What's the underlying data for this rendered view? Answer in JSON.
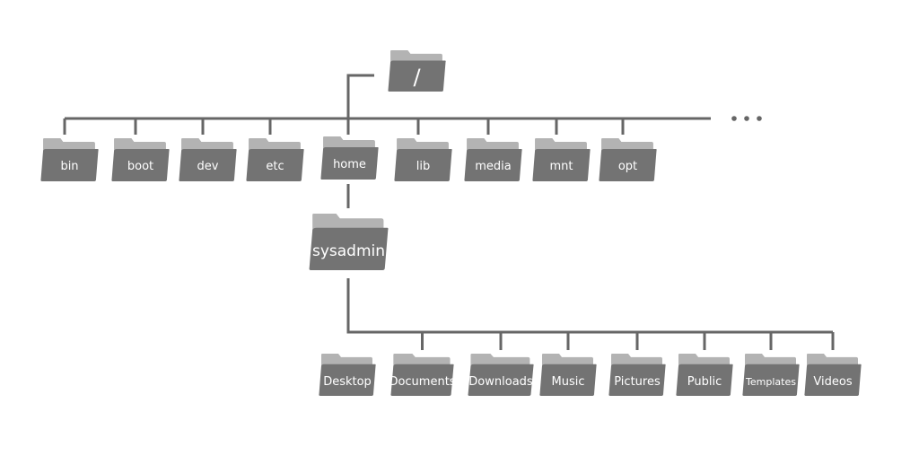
{
  "colors": {
    "line": "#666666",
    "folder_back": "#b3b3b3",
    "folder_front": "#737373",
    "label": "#ffffff"
  },
  "root": {
    "label": "/"
  },
  "more_indicator": "...",
  "level1": [
    "bin",
    "boot",
    "dev",
    "etc",
    "home",
    "lib",
    "media",
    "mnt",
    "opt"
  ],
  "user": {
    "label": "sysadmin"
  },
  "home_dirs": [
    "Desktop",
    "Documents",
    "Downloads",
    "Music",
    "Pictures",
    "Public",
    "Templates",
    "Videos"
  ]
}
